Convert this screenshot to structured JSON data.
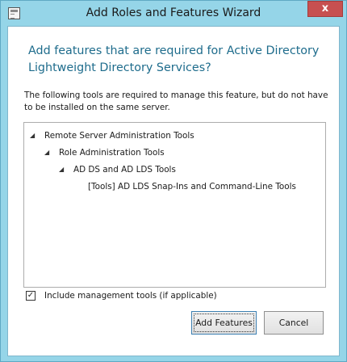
{
  "window": {
    "title": "Add Roles and Features Wizard",
    "close_label": "x"
  },
  "dialog": {
    "heading": "Add features that are required for Active Directory Lightweight Directory Services?",
    "description": "The following tools are required to manage this feature, but do not have to be installed on the same server."
  },
  "tree": {
    "items": [
      {
        "label": "Remote Server Administration Tools",
        "expanded": true
      },
      {
        "label": "Role Administration Tools",
        "expanded": true
      },
      {
        "label": "AD DS and AD LDS Tools",
        "expanded": true
      },
      {
        "label": "[Tools] AD LDS Snap-Ins and Command-Line Tools",
        "expanded": false
      }
    ],
    "expand_glyph": "◢"
  },
  "options": {
    "include_tools_label": "Include management tools (if applicable)",
    "include_tools_checked": true,
    "check_glyph": "✓"
  },
  "buttons": {
    "add_features": "Add Features",
    "cancel": "Cancel"
  }
}
